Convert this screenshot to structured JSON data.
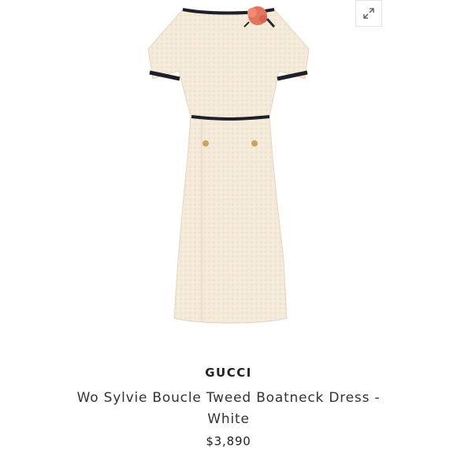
{
  "product": {
    "brand": "GUCCI",
    "title": "Wo Sylvie Boucle Tweed Boatneck Dress - White",
    "price": "$3,890"
  },
  "icons": {
    "expand": "expand-diagonal-arrows-icon"
  },
  "colors": {
    "dress": "#f4ead9",
    "trim": "#1f1f2b",
    "flower": "#e4745f",
    "button_gold": "#c8a55a"
  }
}
